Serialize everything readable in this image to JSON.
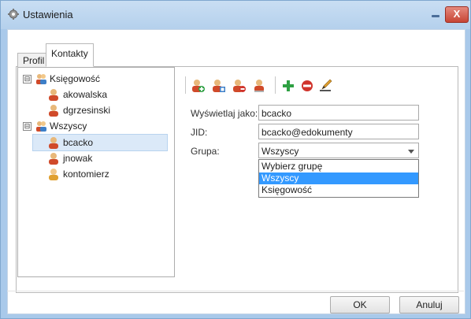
{
  "window": {
    "title": "Ustawienia",
    "close_glyph": "X"
  },
  "tabs": [
    {
      "label": "Profil"
    },
    {
      "label": "Kontakty"
    }
  ],
  "tree": {
    "groups": [
      {
        "label": "Księgowość",
        "expander": "⊟",
        "members": [
          "akowalska",
          "dgrzesinski"
        ]
      },
      {
        "label": "Wszyscy",
        "expander": "⊟",
        "members": [
          "bcacko",
          "jnowak",
          "kontomierz"
        ]
      }
    ],
    "selected": "bcacko"
  },
  "form": {
    "display_label": "Wyświetlaj jako:",
    "display_value": "bcacko",
    "jid_label": "JID:",
    "jid_value": "bcacko@edokumenty",
    "group_label": "Grupa:",
    "group_value": "Wszyscy",
    "group_options": [
      "Wybierz grupę",
      "Wszyscy",
      "Księgowość"
    ],
    "group_highlighted": "Wszyscy"
  },
  "toolbar": {
    "icons": [
      "user-add-icon",
      "user-edit-icon",
      "user-remove-icon",
      "user-icon",
      "plus-icon",
      "minus-icon",
      "edit-icon"
    ]
  },
  "buttons": {
    "ok": "OK",
    "cancel": "Anuluj"
  },
  "colors": {
    "titlebar": "#b4d0ec",
    "close": "#c74535",
    "selection": "#3399ff",
    "tree_selection": "#dbe9f8",
    "plus": "#2ea043",
    "minus": "#d0342c"
  }
}
